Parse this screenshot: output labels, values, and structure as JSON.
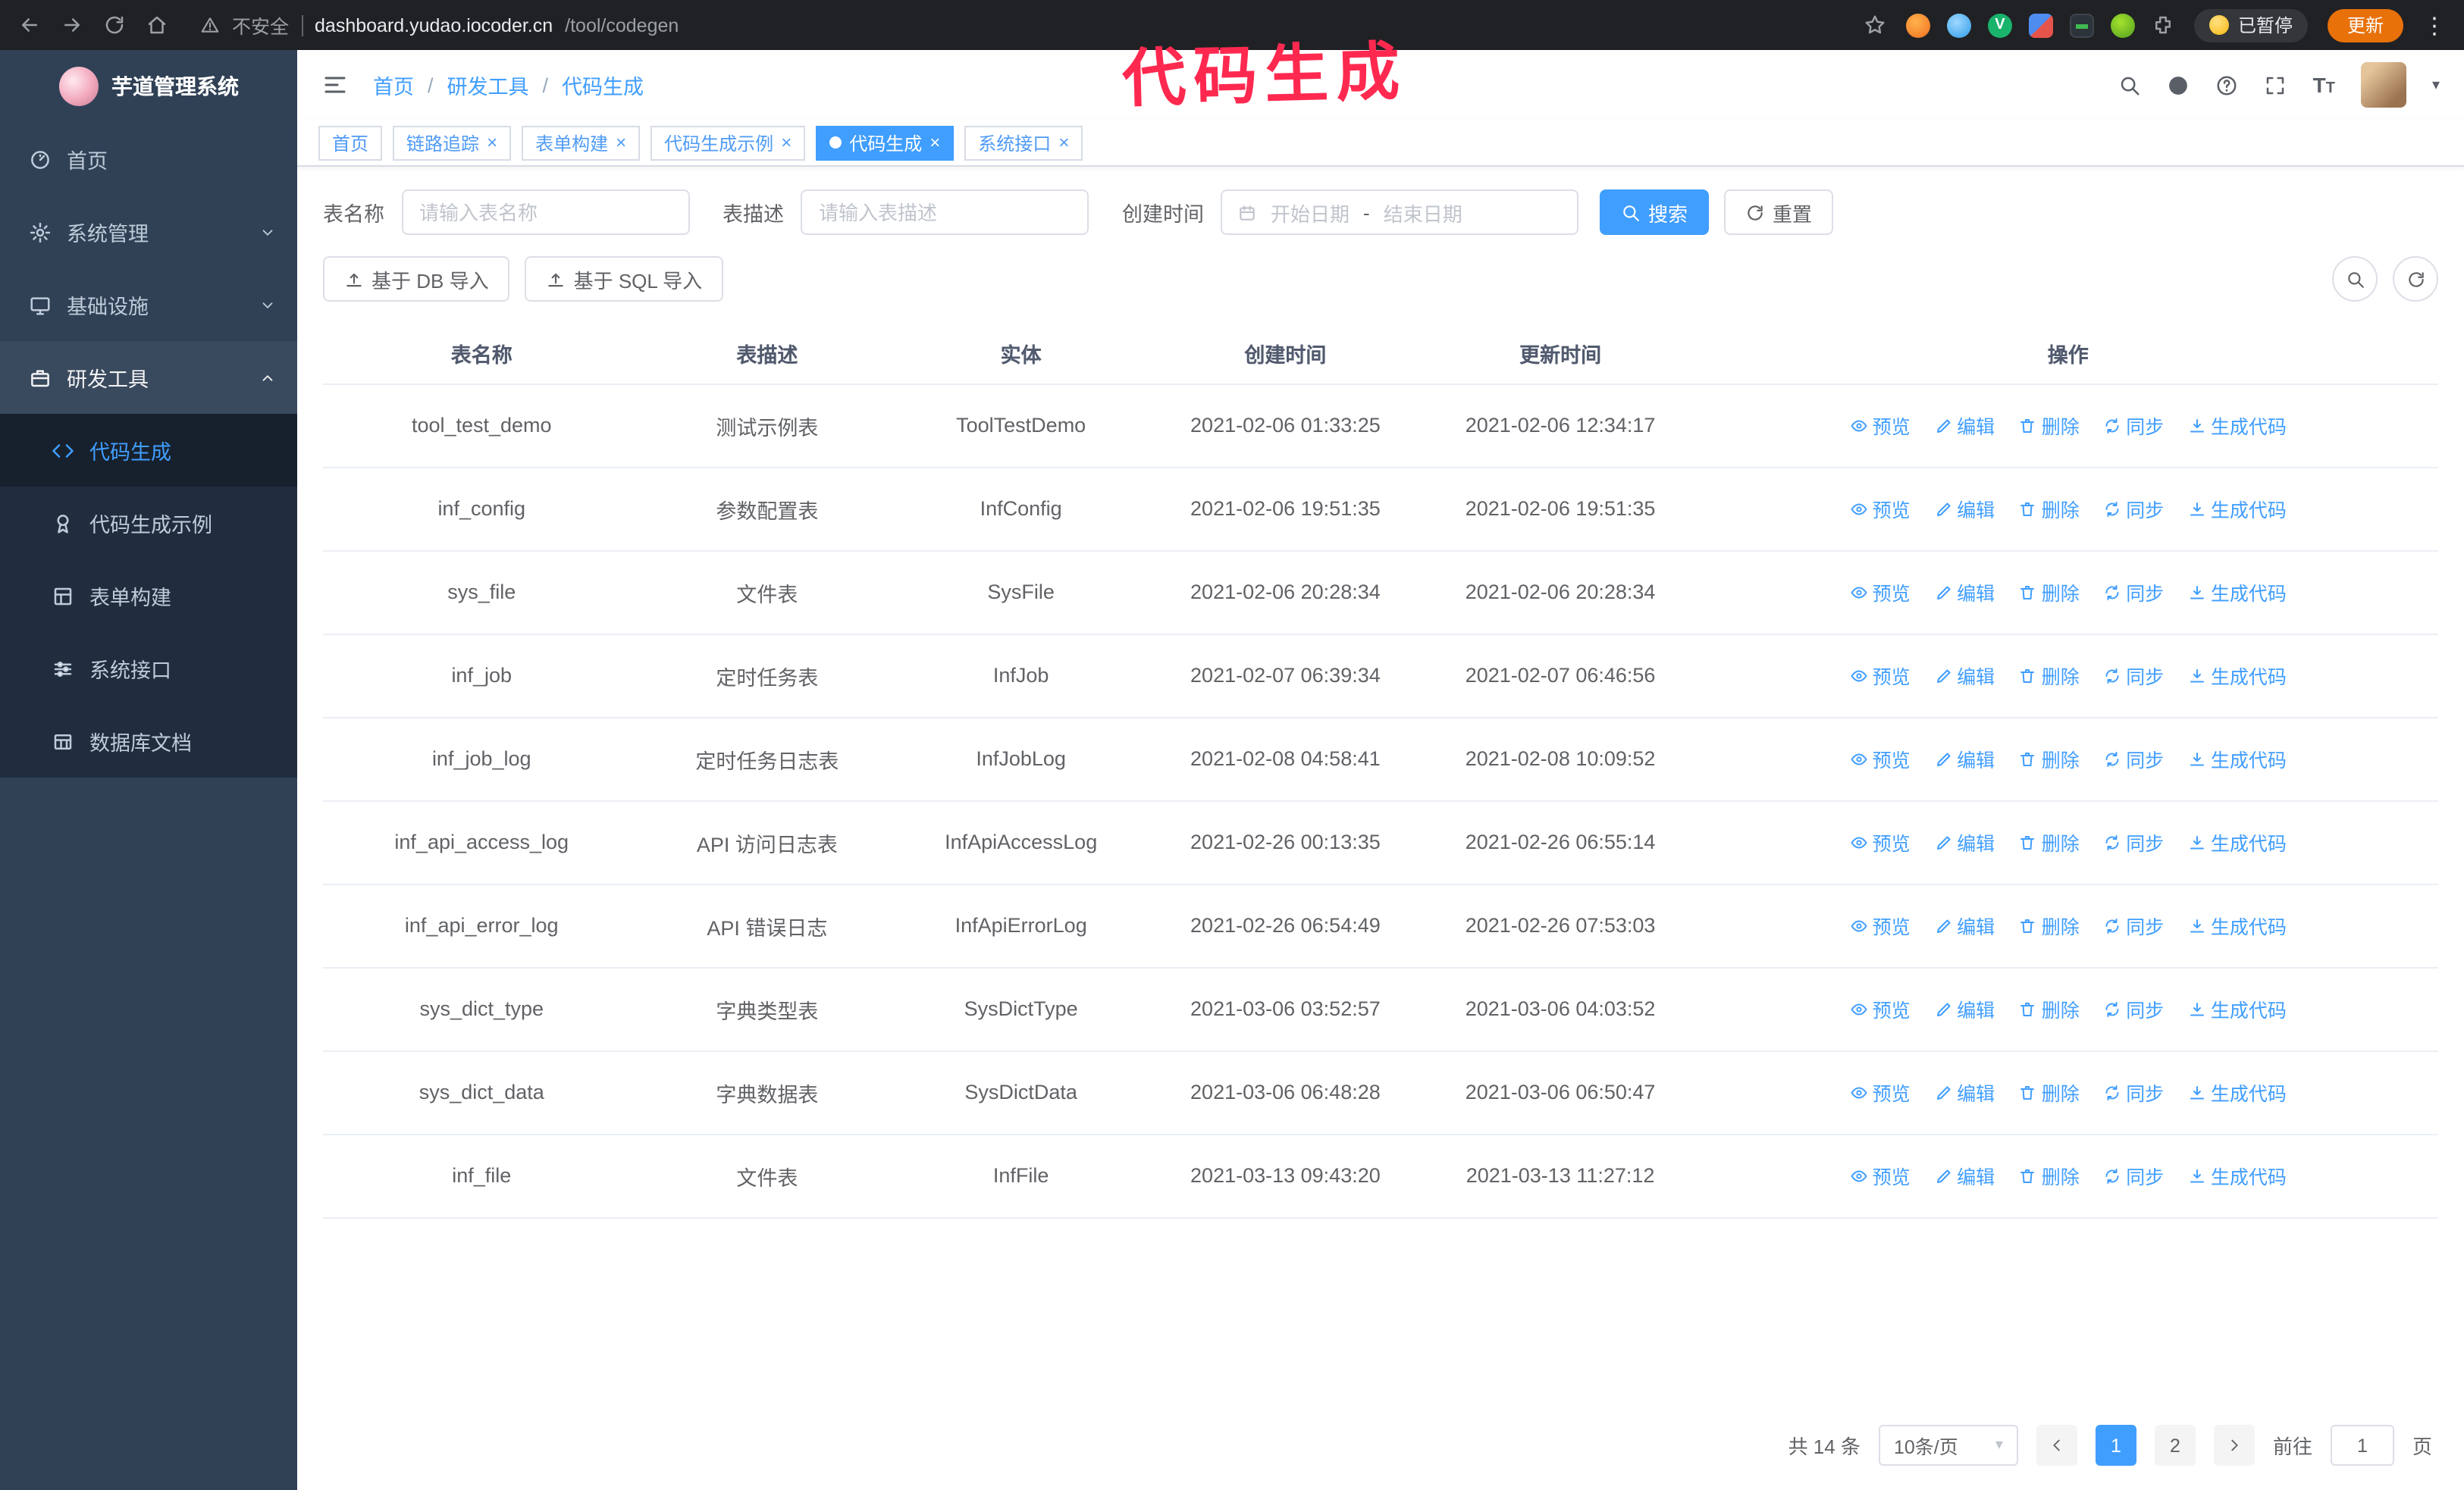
{
  "colors": {
    "accent": "#409eff",
    "annotation": "#ff2950",
    "sidebar_bg": "#304156",
    "submenu_bg": "#1f2d3e",
    "update_button_bg": "#e8710a"
  },
  "browser": {
    "security_label": "不安全",
    "url_host": "dashboard.yudao.iocoder.cn",
    "url_path": "/tool/codegen",
    "paused_badge": "已暂停",
    "update_button": "更新"
  },
  "annotation": {
    "text": "代码生成"
  },
  "sidebar": {
    "logo_title": "芋道管理系统",
    "items": [
      {
        "label": "首页"
      },
      {
        "label": "系统管理"
      },
      {
        "label": "基础设施"
      },
      {
        "label": "研发工具"
      }
    ],
    "subitems": [
      {
        "label": "代码生成"
      },
      {
        "label": "代码生成示例"
      },
      {
        "label": "表单构建"
      },
      {
        "label": "系统接口"
      },
      {
        "label": "数据库文档"
      }
    ]
  },
  "breadcrumb": {
    "items": [
      "首页",
      "研发工具",
      "代码生成"
    ],
    "separator": "/"
  },
  "tabs": [
    {
      "label": "首页"
    },
    {
      "label": "链路追踪"
    },
    {
      "label": "表单构建"
    },
    {
      "label": "代码生成示例"
    },
    {
      "label": "代码生成"
    },
    {
      "label": "系统接口"
    }
  ],
  "filters": {
    "name_label": "表名称",
    "name_placeholder": "请输入表名称",
    "desc_label": "表描述",
    "desc_placeholder": "请输入表描述",
    "time_label": "创建时间",
    "start_placeholder": "开始日期",
    "range_separator": "-",
    "end_placeholder": "结束日期",
    "search": "搜索",
    "reset": "重置"
  },
  "toolbar": {
    "import_db": "基于 DB 导入",
    "import_sql": "基于 SQL 导入"
  },
  "table": {
    "columns": [
      "表名称",
      "表描述",
      "实体",
      "创建时间",
      "更新时间",
      "操作"
    ],
    "actions": [
      "预览",
      "编辑",
      "删除",
      "同步",
      "生成代码"
    ],
    "rows": [
      {
        "name": "tool_test_demo",
        "desc": "测试示例表",
        "entity": "ToolTestDemo",
        "created": "2021-02-06 01:33:25",
        "updated": "2021-02-06 12:34:17"
      },
      {
        "name": "inf_config",
        "desc": "参数配置表",
        "entity": "InfConfig",
        "created": "2021-02-06 19:51:35",
        "updated": "2021-02-06 19:51:35"
      },
      {
        "name": "sys_file",
        "desc": "文件表",
        "entity": "SysFile",
        "created": "2021-02-06 20:28:34",
        "updated": "2021-02-06 20:28:34"
      },
      {
        "name": "inf_job",
        "desc": "定时任务表",
        "entity": "InfJob",
        "created": "2021-02-07 06:39:34",
        "updated": "2021-02-07 06:46:56"
      },
      {
        "name": "inf_job_log",
        "desc": "定时任务日志表",
        "entity": "InfJobLog",
        "created": "2021-02-08 04:58:41",
        "updated": "2021-02-08 10:09:52"
      },
      {
        "name": "inf_api_access_log",
        "desc": "API 访问日志表",
        "entity": "InfApiAccessLog",
        "created": "2021-02-26 00:13:35",
        "updated": "2021-02-26 06:55:14"
      },
      {
        "name": "inf_api_error_log",
        "desc": "API 错误日志",
        "entity": "InfApiErrorLog",
        "created": "2021-02-26 06:54:49",
        "updated": "2021-02-26 07:53:03"
      },
      {
        "name": "sys_dict_type",
        "desc": "字典类型表",
        "entity": "SysDictType",
        "created": "2021-03-06 03:52:57",
        "updated": "2021-03-06 04:03:52"
      },
      {
        "name": "sys_dict_data",
        "desc": "字典数据表",
        "entity": "SysDictData",
        "created": "2021-03-06 06:48:28",
        "updated": "2021-03-06 06:50:47"
      },
      {
        "name": "inf_file",
        "desc": "文件表",
        "entity": "InfFile",
        "created": "2021-03-13 09:43:20",
        "updated": "2021-03-13 11:27:12"
      }
    ]
  },
  "pagination": {
    "total": "共 14 条",
    "page_size": "10条/页",
    "page1": "1",
    "page2": "2",
    "goto_label": "前往",
    "goto_value": "1",
    "goto_suffix": "页"
  }
}
